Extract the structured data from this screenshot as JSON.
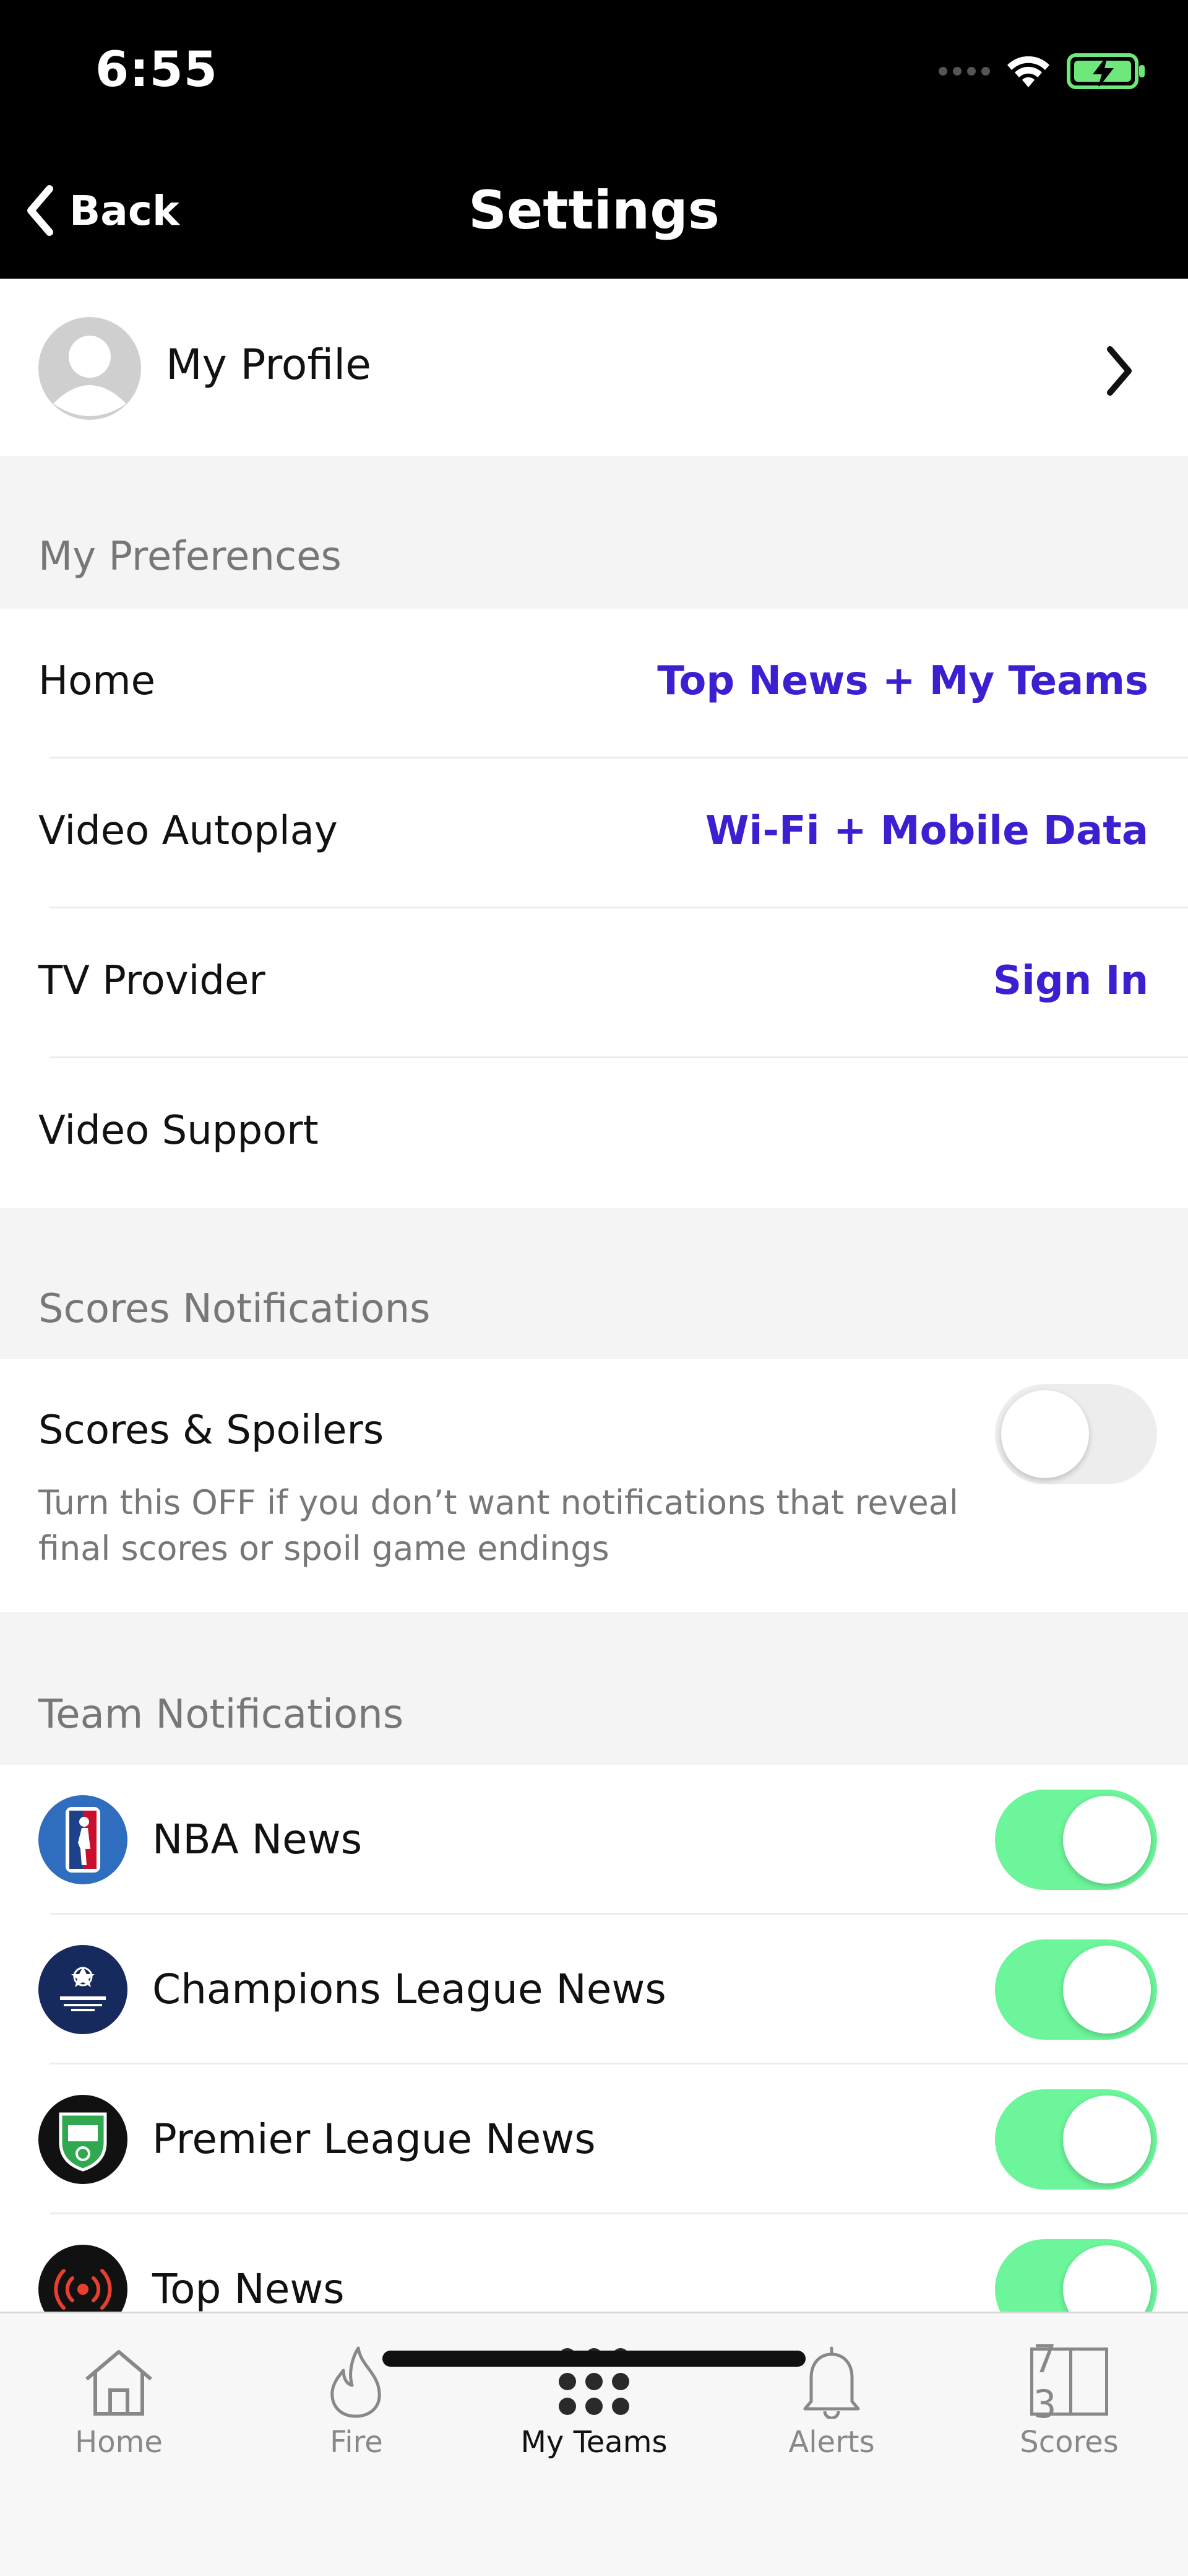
{
  "status": {
    "time": "6:55"
  },
  "nav": {
    "back_label": "Back",
    "title": "Settings"
  },
  "profile": {
    "label": "My Profile"
  },
  "preferences": {
    "header": "My Preferences",
    "items": [
      {
        "label": "Home",
        "value": "Top News + My Teams"
      },
      {
        "label": "Video Autoplay",
        "value": "Wi-Fi + Mobile Data"
      },
      {
        "label": "TV Provider",
        "value": "Sign In"
      },
      {
        "label": "Video Support",
        "value": ""
      }
    ]
  },
  "scores_notifications": {
    "header": "Scores Notifications",
    "item": {
      "label": "Scores & Spoilers",
      "description_line1": "Turn this OFF if you don’t want notifications that reveal",
      "description_line2": "final scores or spoil game endings",
      "enabled": false
    }
  },
  "team_notifications": {
    "header": "Team Notifications",
    "items": [
      {
        "label": "NBA News",
        "icon": "nba-logo-icon",
        "enabled": true
      },
      {
        "label": "Champions League News",
        "icon": "champions-league-logo-icon",
        "enabled": true
      },
      {
        "label": "Premier League News",
        "icon": "premier-league-logo-icon",
        "enabled": true
      },
      {
        "label": "Top News",
        "icon": "top-news-broadcast-icon",
        "enabled": true
      }
    ]
  },
  "tabbar": {
    "tabs": [
      {
        "label": "Home",
        "icon": "home-icon",
        "active": false
      },
      {
        "label": "Fire",
        "icon": "fire-icon",
        "active": false
      },
      {
        "label": "My Teams",
        "icon": "grid-dots-icon",
        "active": true
      },
      {
        "label": "Alerts",
        "icon": "bell-icon",
        "active": false
      },
      {
        "label": "Scores",
        "icon": "scoreboard-icon",
        "active": false
      }
    ],
    "scores_icon_digits": "7 3"
  },
  "colors": {
    "accent": "#3c1fd0",
    "toggle_on": "#6cf59a",
    "nav_background": "#000000"
  }
}
